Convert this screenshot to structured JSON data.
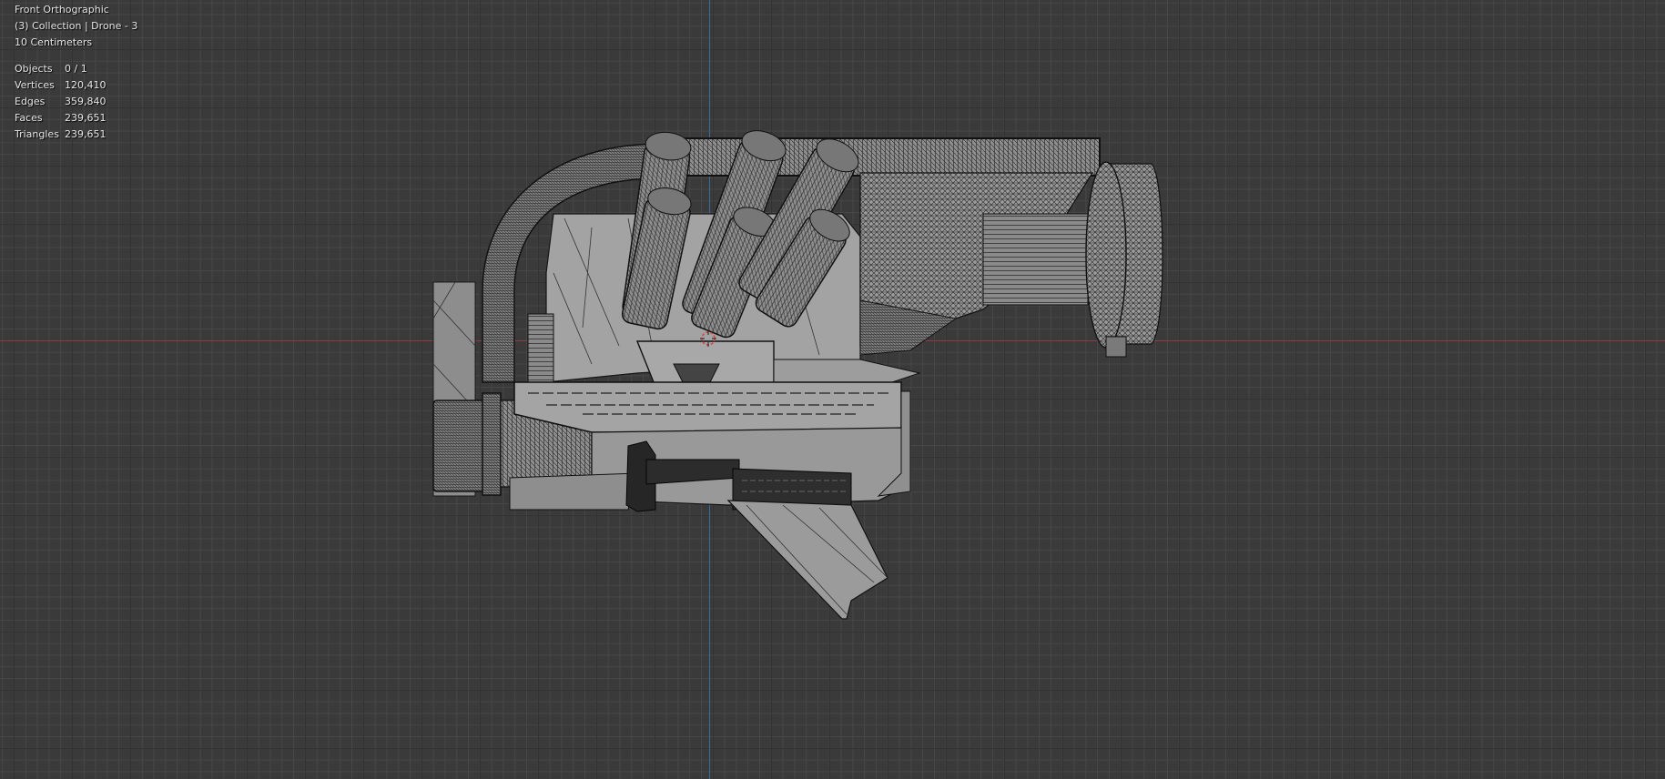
{
  "viewport": {
    "view_name": "Front Orthographic",
    "collection_info": "(3) Collection | Drone - 3",
    "grid_scale": "10 Centimeters",
    "stats": [
      {
        "label": "Objects",
        "value": "0 / 1"
      },
      {
        "label": "Vertices",
        "value": "120,410"
      },
      {
        "label": "Edges",
        "value": "359,840"
      },
      {
        "label": "Faces",
        "value": "239,651"
      },
      {
        "label": "Triangles",
        "value": "239,651"
      }
    ]
  },
  "colors": {
    "background": "#3a3a3a",
    "x_axis": "#8c3a43",
    "z_axis": "#3b6b9a",
    "mesh_fill": "#9a9a9a",
    "wire": "#1a1a1a",
    "cursor": "#d64545"
  }
}
